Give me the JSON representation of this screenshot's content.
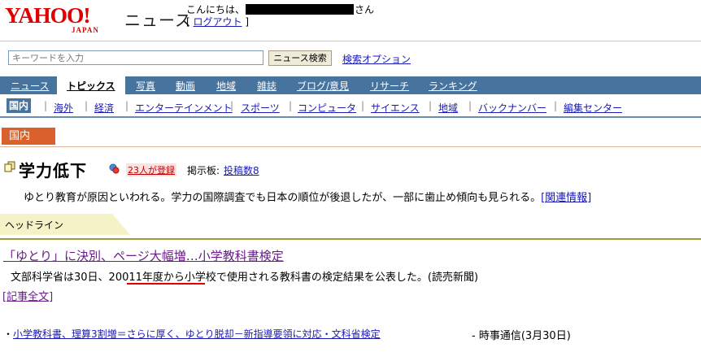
{
  "header": {
    "logo_text": "YAHOO!",
    "logo_sub": "JAPAN",
    "section_title": "ニュース",
    "greeting_prefix": "こんにちは、",
    "greeting_suffix": "さん",
    "logout_label": "ログアウト",
    "bracket_open": "[ ",
    "bracket_close": " ]"
  },
  "search": {
    "placeholder": "キーワードを入力",
    "button_label": "ニュース検索",
    "options_label": "検索オプション"
  },
  "nav": {
    "items": [
      "ニュース",
      "トピックス",
      "写真",
      "動画",
      "地域",
      "雑誌",
      "ブログ/意見",
      "リサーチ",
      "ランキング"
    ],
    "active_index": 1
  },
  "subnav": {
    "items": [
      "国内",
      "海外",
      "経済",
      "エンターテインメント",
      "スポーツ",
      "コンピュータ",
      "サイエンス",
      "地域",
      "バックナンバー",
      "編集センター"
    ],
    "separator": "|",
    "active_index": 0
  },
  "category_tab": "国内",
  "topic": {
    "title": "学力低下",
    "registered_label": "23人が登録",
    "board_label": "掲示板:",
    "board_link": "投稿数8",
    "description": "ゆとり教育が原因といわれる。学力の国際調査でも日本の順位が後退したが、一部に歯止め傾向も見られる。",
    "related_link": "[関連情報]"
  },
  "headlines": {
    "label": "ヘッドライン",
    "article": {
      "title": "「ゆとり」に決別、ページ大幅増…小学教科書検定",
      "body": "文部科学省は30日、20011年度から小学校で使用される教科書の検定結果を公表した。(読売新聞)",
      "full_link": "[記事全文]"
    },
    "related": {
      "bullet": "・",
      "link": "小学教科書、理算3割増＝さらに厚く、ゆとり脱却－新指導要領に対応・文科省検定",
      "source": "- 時事通信(3月30日)"
    }
  },
  "colors": {
    "brand_red": "#e00000",
    "nav_bg": "#46749e",
    "category_orange": "#d9612b",
    "link_blue": "#1a1ab4",
    "visited_purple": "#6a1d8a",
    "headline_line": "#9a9c40"
  },
  "icons": [
    "topic-pages-icon",
    "registration-icon"
  ]
}
